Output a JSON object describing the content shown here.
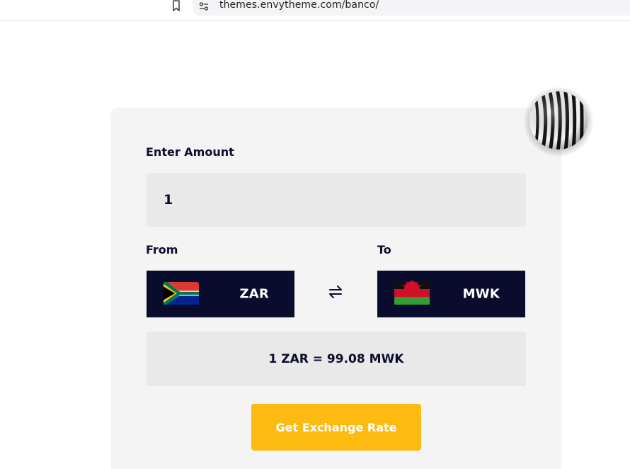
{
  "browser": {
    "url": "themes.envytheme.com/banco/"
  },
  "converter": {
    "amount_label": "Enter Amount",
    "amount_value": "1",
    "from_label": "From",
    "to_label": "To",
    "from_currency": "ZAR",
    "to_currency": "MWK",
    "rate_text": "1 ZAR = 99.08 MWK",
    "cta_label": "Get Exchange Rate"
  },
  "icons": {
    "bookmark": "bookmark-icon",
    "site_settings": "site-settings-icon",
    "swap": "swap-icon",
    "from_flag": "south-africa-flag-icon",
    "to_flag": "malawi-flag-icon"
  },
  "colors": {
    "card_bg": "#f4f4f4",
    "field_bg": "#e9e9e9",
    "select_bg": "#0a0c2e",
    "cta_bg": "#fdbb12",
    "text_dark": "#0b0d2b"
  }
}
